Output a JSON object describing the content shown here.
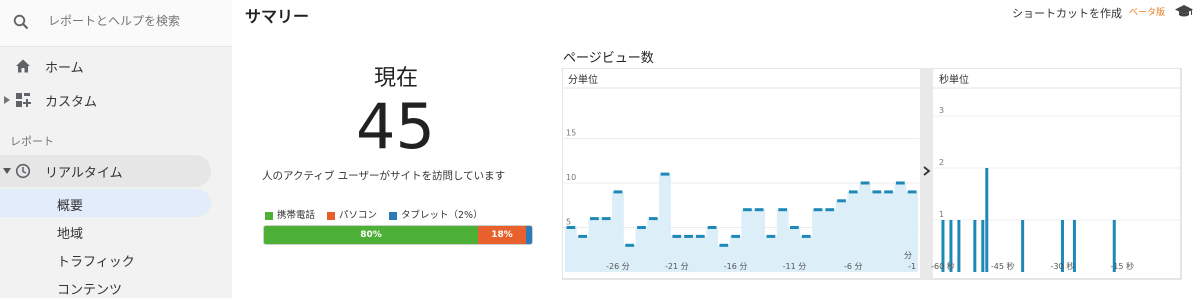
{
  "sidebar": {
    "search_placeholder": "レポートとヘルプを検索",
    "home": "ホーム",
    "custom": "カスタム",
    "reports_section": "レポート",
    "realtime": "リアルタイム",
    "sub_items": [
      "概要",
      "地域",
      "トラフィック",
      "コンテンツ"
    ],
    "active_sub_item": "概要"
  },
  "header": {
    "title": "サマリー",
    "shortcut": "ショートカットを作成",
    "beta": "ベータ版"
  },
  "summary": {
    "now_label": "現在",
    "active_users": "45",
    "description": "人のアクティブ ユーザーがサイトを訪問しています",
    "devices": [
      {
        "name": "携帯電話",
        "percent": 80,
        "label": "80%",
        "color": "#4caf36"
      },
      {
        "name": "パソコン",
        "percent": 18,
        "label": "18%",
        "color": "#e8602c"
      },
      {
        "name": "タブレット（2%）",
        "percent": 2,
        "label": "",
        "color": "#2b7bb9"
      }
    ]
  },
  "pageviews": {
    "title": "ページビュー数",
    "minute_label": "分単位",
    "second_label": "秒単位"
  },
  "chart_data": [
    {
      "type": "area",
      "title": "分単位",
      "ylabel": "",
      "ylim": [
        0,
        20
      ],
      "yticks": [
        5,
        10,
        15
      ],
      "x_tick_labels": [
        "-26 分",
        "-21 分",
        "-16 分",
        "-11 分",
        "-6 分",
        "-1"
      ],
      "xlabel_fragment": "分",
      "x": [
        -30,
        -29,
        -28,
        -27,
        -26,
        -25,
        -24,
        -23,
        -22,
        -21,
        -20,
        -19,
        -18,
        -17,
        -16,
        -15,
        -14,
        -13,
        -12,
        -11,
        -10,
        -9,
        -8,
        -7,
        -6,
        -5,
        -4,
        -3,
        -2,
        -1
      ],
      "values": [
        5,
        4,
        6,
        6,
        9,
        3,
        5,
        6,
        11,
        4,
        4,
        4,
        5,
        3,
        4,
        7,
        7,
        4,
        7,
        5,
        4,
        7,
        7,
        8,
        9,
        10,
        9,
        9,
        10,
        9
      ],
      "color": "#1e88b8"
    },
    {
      "type": "bar",
      "title": "秒単位",
      "ylim": [
        0,
        3
      ],
      "yticks": [
        1,
        2,
        3
      ],
      "x_tick_labels": [
        "-60 秒",
        "-45 秒",
        "-30 秒",
        "-15 秒"
      ],
      "x": [
        -59,
        -57,
        -55,
        -51,
        -49,
        -48,
        -39,
        -29,
        -26,
        -16
      ],
      "values": [
        1,
        1,
        1,
        1,
        1,
        2,
        1,
        1,
        1,
        1
      ],
      "color": "#1e88b8"
    }
  ]
}
